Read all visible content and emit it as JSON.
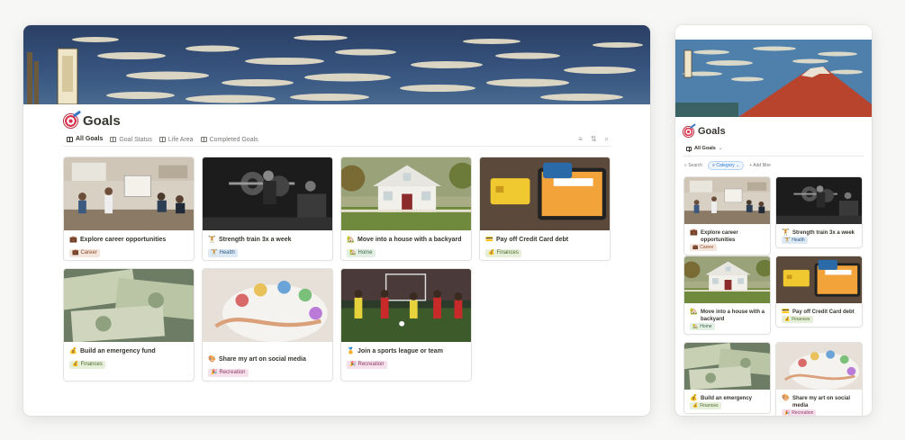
{
  "page": {
    "title": "Goals",
    "icon": "target-dart-icon"
  },
  "tabs": [
    {
      "label": "All Goals",
      "icon": "gallery-icon",
      "active": true
    },
    {
      "label": "Goal Status",
      "icon": "board-icon",
      "active": false
    },
    {
      "label": "Life Area",
      "icon": "board-icon",
      "active": false
    },
    {
      "label": "Completed Goals",
      "icon": "gallery-icon",
      "active": false
    }
  ],
  "tools": [
    {
      "name": "filter-icon",
      "glyph": "≡"
    },
    {
      "name": "sort-icon",
      "glyph": "⇅"
    },
    {
      "name": "search-icon",
      "glyph": "⌕"
    }
  ],
  "tag_colors": {
    "Career": {
      "bg": "#f4e6dc",
      "fg": "#8b4f2a"
    },
    "Health": {
      "bg": "#dde9f4",
      "fg": "#305d87"
    },
    "Home": {
      "bg": "#e3efe4",
      "fg": "#3d6b45"
    },
    "Finances": {
      "bg": "#e6efd9",
      "fg": "#4d6b2d"
    },
    "Recreation": {
      "bg": "#f6e0ec",
      "fg": "#8a3a66"
    }
  },
  "goals": [
    {
      "title": "Explore career opportunities",
      "emoji": "💼",
      "tag": "Career",
      "tag_emoji": "💼",
      "image": "office-meeting"
    },
    {
      "title": "Strength train 3x a week",
      "emoji": "🏋",
      "tag": "Health",
      "tag_emoji": "🏋",
      "image": "gym"
    },
    {
      "title": "Move into a house with a backyard",
      "emoji": "🏡",
      "tag": "Home",
      "tag_emoji": "🏡",
      "image": "house"
    },
    {
      "title": "Pay off Credit Card debt",
      "emoji": "💳",
      "tag": "Finances",
      "tag_emoji": "💰",
      "image": "credit-card"
    },
    {
      "title": "Build an emergency fund",
      "emoji": "💰",
      "tag": "Finances",
      "tag_emoji": "💰",
      "image": "cash"
    },
    {
      "title": "Share my art on social media",
      "emoji": "🎨",
      "tag": "Recreation",
      "tag_emoji": "🎉",
      "image": "paint-palette"
    },
    {
      "title": "Join a sports league or team",
      "emoji": "🏅",
      "tag": "Recreation",
      "tag_emoji": "🎉",
      "image": "soccer"
    }
  ],
  "mobile": {
    "view_label": "All Goals",
    "search_label": "Search",
    "category_label": "Category",
    "add_filter_label": "+ Add filter"
  }
}
